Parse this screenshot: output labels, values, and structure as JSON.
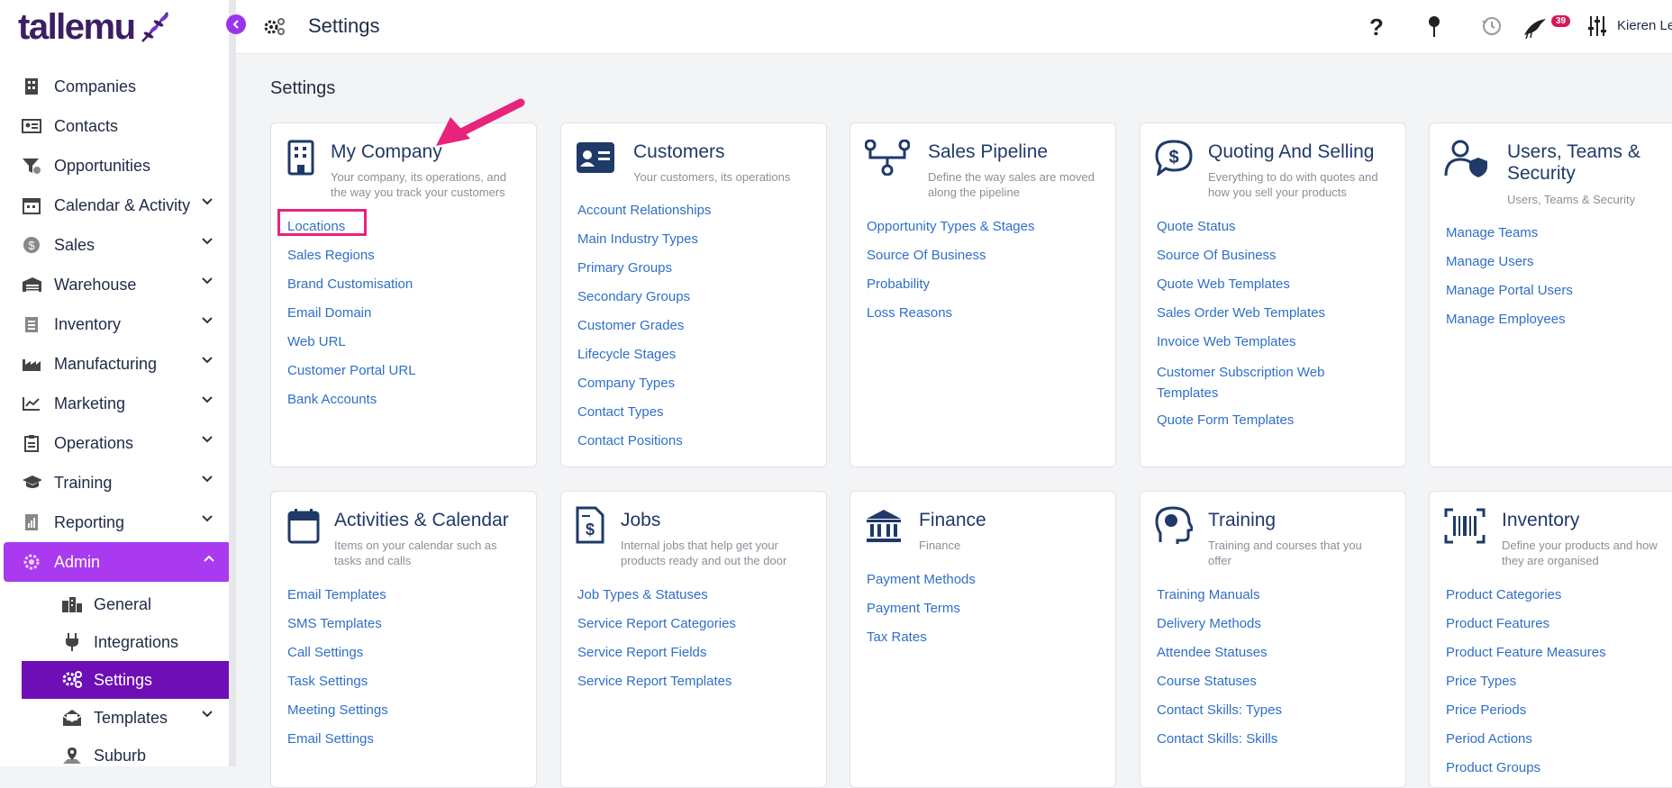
{
  "app": {
    "logo_text": "tallemu"
  },
  "colors": {
    "accent": "#a93aef",
    "accent_dark": "#6d0fb4",
    "link": "#2f6fc7",
    "badge": "#d6185a",
    "annotation": "#e8237c"
  },
  "sidebar": {
    "items": [
      {
        "label": "Companies",
        "icon": "building-icon",
        "chevron": false
      },
      {
        "label": "Contacts",
        "icon": "contact-card-icon",
        "chevron": false
      },
      {
        "label": "Opportunities",
        "icon": "funnel-icon",
        "chevron": false
      },
      {
        "label": "Calendar & Activity",
        "icon": "calendar-icon",
        "chevron": true
      },
      {
        "label": "Sales",
        "icon": "dollar-coin-icon",
        "chevron": true
      },
      {
        "label": "Warehouse",
        "icon": "warehouse-icon",
        "chevron": true
      },
      {
        "label": "Inventory",
        "icon": "clipboard-list-icon",
        "chevron": true
      },
      {
        "label": "Manufacturing",
        "icon": "factory-icon",
        "chevron": true
      },
      {
        "label": "Marketing",
        "icon": "trend-chart-icon",
        "chevron": true
      },
      {
        "label": "Operations",
        "icon": "clipboard-icon",
        "chevron": true
      },
      {
        "label": "Training",
        "icon": "graduation-cap-icon",
        "chevron": true
      },
      {
        "label": "Reporting",
        "icon": "report-icon",
        "chevron": true
      },
      {
        "label": "Admin",
        "icon": "admin-gear-icon",
        "chevron": true,
        "active": true
      }
    ],
    "admin_sub": [
      {
        "label": "General",
        "icon": "city-icon"
      },
      {
        "label": "Integrations",
        "icon": "plug-icon"
      },
      {
        "label": "Settings",
        "icon": "gears-icon",
        "active": true
      },
      {
        "label": "Templates",
        "icon": "envelope-open-icon",
        "chevron": true
      },
      {
        "label": "Suburb",
        "icon": "map-pin-icon"
      }
    ]
  },
  "topbar": {
    "title": "Settings",
    "notification_count": "39",
    "user_name": "Kieren Le"
  },
  "main": {
    "title": "Settings",
    "cards": [
      {
        "title": "My Company",
        "desc_lines": [
          "Your company, its operations, and",
          "the way you track your customers"
        ],
        "icon": "building-icon",
        "links": [
          "Locations",
          "Sales Regions",
          "Brand Customisation",
          "Email Domain",
          "Web URL",
          "Customer Portal URL",
          "Bank Accounts"
        ]
      },
      {
        "title": "Customers",
        "desc_lines": [
          "Your customers, its operations"
        ],
        "icon": "id-card-icon",
        "links": [
          "Account Relationships",
          "Main Industry Types",
          "Primary Groups",
          "Secondary Groups",
          "Customer Grades",
          "Lifecycle Stages",
          "Company Types",
          "Contact Types",
          "Contact Positions"
        ]
      },
      {
        "title": "Sales Pipeline",
        "desc_lines": [
          "Define the way sales are moved",
          "along the pipeline"
        ],
        "icon": "pipeline-icon",
        "links": [
          "Opportunity Types & Stages",
          "Source Of Business",
          "Probability",
          "Loss Reasons"
        ]
      },
      {
        "title": "Quoting And Selling",
        "desc_lines": [
          "Everything to do with quotes and",
          "how you sell your products"
        ],
        "icon": "dollar-chat-icon",
        "links": [
          "Quote Status",
          "Source Of Business",
          "Quote Web Templates",
          "Sales Order Web Templates",
          "Invoice Web Templates",
          "Customer Subscription Web",
          "Templates",
          "Quote Form Templates"
        ]
      },
      {
        "title_lines": [
          "Users, Teams &",
          "Security"
        ],
        "desc_lines": [
          "Users, Teams & Security"
        ],
        "icon": "user-shield-icon",
        "links": [
          "Manage Teams",
          "Manage Users",
          "Manage Portal Users",
          "Manage Employees"
        ]
      },
      {
        "title": "Activities & Calendar",
        "desc_lines": [
          "Items on your calendar such as",
          "tasks and calls"
        ],
        "icon": "calendar-icon",
        "links": [
          "Email Templates",
          "SMS Templates",
          "Call Settings",
          "Task Settings",
          "Meeting Settings",
          "Email Settings"
        ]
      },
      {
        "title": "Jobs",
        "desc_lines": [
          "Internal jobs that help get your",
          "products ready and out the door"
        ],
        "icon": "invoice-dollar-icon",
        "links": [
          "Job Types & Statuses",
          "Service Report Categories",
          "Service Report Fields",
          "Service Report Templates"
        ]
      },
      {
        "title": "Finance",
        "desc_lines": [
          "Finance"
        ],
        "icon": "bank-icon",
        "links": [
          "Payment Methods",
          "Payment Terms",
          "Tax Rates"
        ]
      },
      {
        "title": "Training",
        "desc_lines": [
          "Training and courses that you",
          "offer"
        ],
        "icon": "head-brain-icon",
        "links": [
          "Training Manuals",
          "Delivery Methods",
          "Attendee Statuses",
          "Course Statuses",
          "Contact Skills: Types",
          "Contact Skills: Skills"
        ]
      },
      {
        "title": "Inventory",
        "desc_lines": [
          "Define your products and how",
          "they are organised"
        ],
        "icon": "barcode-icon",
        "links": [
          "Product Categories",
          "Product Features",
          "Product Feature Measures",
          "Price Types",
          "Price Periods",
          "Period Actions",
          "Product Groups"
        ]
      }
    ]
  }
}
